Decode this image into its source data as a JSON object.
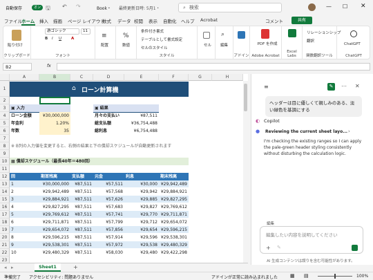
{
  "titlebar": {
    "autosave": "自動保存",
    "toggle": "オン",
    "filename": "Book・",
    "saved": "最終更新日時: 5月1・",
    "search": "検索"
  },
  "menu": {
    "items": [
      "ファイル",
      "ホーム",
      "挿入",
      "描画",
      "ページ レイアウト",
      "数式",
      "データ",
      "校閲",
      "表示",
      "自動化",
      "ヘルプ",
      "Acrobat"
    ],
    "comment": "コメント",
    "share": "共有"
  },
  "ribbon": {
    "paste": "貼り付け",
    "clipboard": "クリップボード",
    "font_name": "游ゴシック",
    "font_size": "11",
    "font": "フォント",
    "align": "配置",
    "number": "数値",
    "percent": "%",
    "cond_format": "条件付き書式",
    "table_format": "テーブルとして書式設定",
    "cell_style": "セルのスタイル",
    "style": "スタイル",
    "cell": "セル",
    "edit": "編集",
    "addin": "アドイン",
    "pdf_create": "PDF を作成",
    "adobe": "Adobe Acrobat",
    "excel_labs": "Excel Labs",
    "relationship": "リレーションシップ",
    "translate": "翻訳",
    "translate_tool": "関数翻訳ツール",
    "chatgpt": "ChatGPT"
  },
  "formula": {
    "namebox": "B2",
    "fx": "fx"
  },
  "sheet": {
    "columns": [
      "A",
      "B",
      "C",
      "D",
      "E",
      "F",
      "G",
      "H"
    ],
    "title": "ローン計算機",
    "input_header": "入力",
    "result_header": "結果",
    "inputs": [
      {
        "label": "ローン金額",
        "value": "¥30,000,000"
      },
      {
        "label": "年金利",
        "value": "1.20%"
      },
      {
        "label": "年数",
        "value": "35"
      }
    ],
    "results": [
      {
        "label": "月々の支払い",
        "value": "¥87,511"
      },
      {
        "label": "総支払額",
        "value": "¥36,754,488"
      },
      {
        "label": "総利息",
        "value": "¥6,754,488"
      }
    ],
    "note": "※ B列の入力値を変更すると、右側の結果と下の償却スケジュールが自動更新されます",
    "schedule_title": "償却スケジュール（最長40年＝480回）",
    "headers": [
      "回",
      "期首残高",
      "支払額",
      "元金",
      "利息",
      "期末残高"
    ],
    "rows": [
      [
        "1",
        "¥30,000,000",
        "¥87,511",
        "¥57,511",
        "¥30,000",
        "¥29,942,489"
      ],
      [
        "2",
        "¥29,942,489",
        "¥87,511",
        "¥57,568",
        "¥29,942",
        "¥29,884,921"
      ],
      [
        "3",
        "¥29,884,921",
        "¥87,511",
        "¥57,626",
        "¥29,885",
        "¥29,827,295"
      ],
      [
        "4",
        "¥29,827,295",
        "¥87,511",
        "¥57,683",
        "¥29,827",
        "¥29,769,612"
      ],
      [
        "5",
        "¥29,769,612",
        "¥87,511",
        "¥57,741",
        "¥29,770",
        "¥29,711,871"
      ],
      [
        "6",
        "¥29,711,871",
        "¥87,511",
        "¥57,799",
        "¥29,712",
        "¥29,654,072"
      ],
      [
        "7",
        "¥29,654,072",
        "¥87,511",
        "¥57,856",
        "¥29,654",
        "¥29,596,215"
      ],
      [
        "8",
        "¥29,596,215",
        "¥87,511",
        "¥57,914",
        "¥29,596",
        "¥29,538,301"
      ],
      [
        "9",
        "¥29,538,301",
        "¥87,511",
        "¥57,972",
        "¥29,538",
        "¥29,480,329"
      ],
      [
        "10",
        "¥29,480,329",
        "¥87,511",
        "¥58,030",
        "¥29,480",
        "¥29,422,298"
      ]
    ],
    "row_numbers": [
      "1",
      "2",
      "3",
      "4",
      "5",
      "6",
      "7",
      "8",
      "9",
      "10",
      "11",
      "12",
      "13",
      "14",
      "15",
      "16",
      "17",
      "18",
      "19",
      "20",
      "21",
      "22",
      "23"
    ],
    "sheet_tab": "Sheet1"
  },
  "copilot": {
    "user_msg": "ヘッダーは目に優しくて親しみのある、淡い緑色を基調にする",
    "name": "Copilot",
    "step": "Reviewing the current sheet layo...",
    "reply": "I'm checking the existing ranges so I can apply the pale-green header styling consistently without disturbing the calculation logic.",
    "mode": "編集",
    "placeholder": "編集したい内容を説明してください",
    "disclaimer": "AI 生成コンテンツは誤りを含む可能性があります。"
  },
  "status": {
    "ready": "準備完了",
    "accessibility": "アクセシビリティ: 問題ありません",
    "addin_note": "アドインが正常に読み込まれました",
    "zoom": "100%"
  },
  "colors": {
    "accent": "#117a3c",
    "title_bg": "#1f4e79",
    "header_bg": "#2e75b6",
    "band": "#ddebf7",
    "input_fill": "#fff2cc"
  }
}
